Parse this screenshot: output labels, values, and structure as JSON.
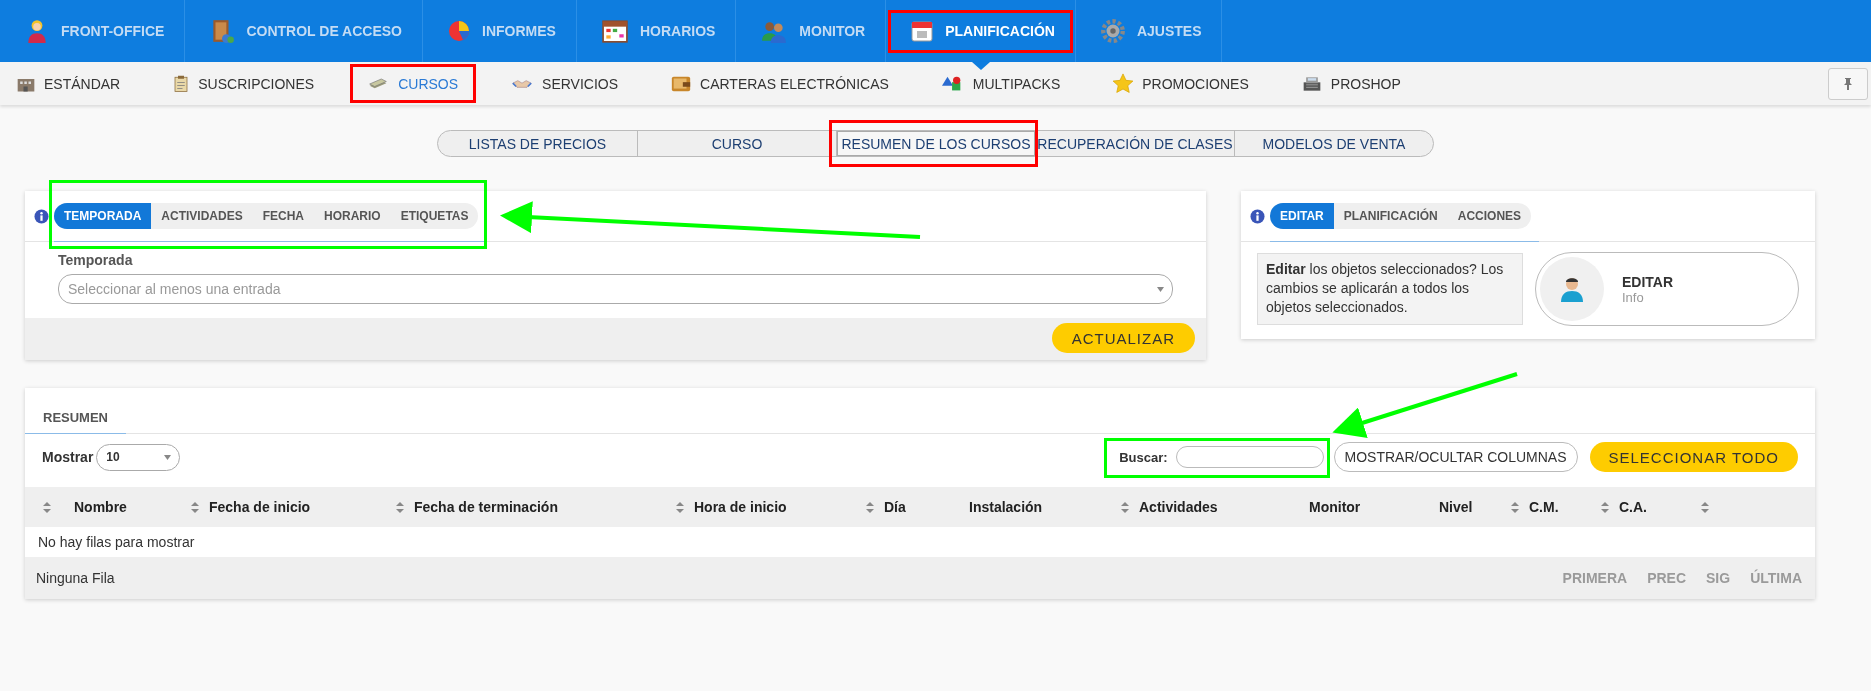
{
  "main_menu": [
    {
      "label": "FRONT-OFFICE",
      "selected": false
    },
    {
      "label": "CONTROL DE ACCESO",
      "selected": false
    },
    {
      "label": "INFORMES",
      "selected": false
    },
    {
      "label": "HORARIOS",
      "selected": false
    },
    {
      "label": "MONITOR",
      "selected": false
    },
    {
      "label": "PLANIFICACIÓN",
      "selected": true,
      "highlighted": true
    },
    {
      "label": "AJUSTES",
      "selected": false
    }
  ],
  "sub_menu": [
    {
      "label": "ESTÁNDAR",
      "selected": false
    },
    {
      "label": "SUSCRIPCIONES",
      "selected": false
    },
    {
      "label": "CURSOS",
      "selected": true,
      "highlighted": true
    },
    {
      "label": "SERVICIOS",
      "selected": false
    },
    {
      "label": "CARTERAS ELECTRÓNICAS",
      "selected": false
    },
    {
      "label": "MULTIPACKS",
      "selected": false
    },
    {
      "label": "PROMOCIONES",
      "selected": false
    },
    {
      "label": "PROSHOP",
      "selected": false
    }
  ],
  "view_tabs": [
    {
      "label": "LISTAS DE PRECIOS",
      "selected": false
    },
    {
      "label": "CURSO",
      "selected": false
    },
    {
      "label": "RESUMEN DE LOS CURSOS",
      "selected": true,
      "highlighted": true
    },
    {
      "label": "RECUPERACIÓN DE CLASES",
      "selected": false
    },
    {
      "label": "MODELOS DE VENTA",
      "selected": false
    }
  ],
  "filter_panel": {
    "tabs_highlighted": true,
    "tabs": [
      {
        "label": "TEMPORADA",
        "selected": true
      },
      {
        "label": "ACTIVIDADES",
        "selected": false
      },
      {
        "label": "FECHA",
        "selected": false
      },
      {
        "label": "HORARIO",
        "selected": false
      },
      {
        "label": "ETIQUETAS",
        "selected": false
      }
    ],
    "field_label": "Temporada",
    "field_placeholder": "Seleccionar al menos una entrada",
    "button": "ACTUALIZAR"
  },
  "action_panel": {
    "tabs": [
      {
        "label": "EDITAR",
        "selected": true
      },
      {
        "label": "PLANIFICACIÓN",
        "selected": false
      },
      {
        "label": "ACCIONES",
        "selected": false
      }
    ],
    "description": "**Editar** los objetos seleccionados? Los cambios se aplicarán a todos los objetos seleccionados.",
    "action_title": "EDITAR",
    "action_subtitle": "Info"
  },
  "summary": {
    "tab": "RESUMEN",
    "show_label": "Mostrar",
    "page_size": "10",
    "search_label": "Buscar:",
    "search_highlighted": true,
    "columns_button": "MOSTRAR/OCULTAR COLUMNAS",
    "select_all_button": "SELECCIONAR TODO",
    "columns": [
      {
        "sortable": true
      },
      {
        "label": "Nombre",
        "sortable": true
      },
      {
        "label": "Fecha de inicio",
        "sortable": true
      },
      {
        "label": "Fecha de terminación",
        "sortable": true
      },
      {
        "label": "Hora de inicio",
        "sortable": true
      },
      {
        "label": "Día",
        "sortable": false
      },
      {
        "label": "Instalación",
        "sortable": true
      },
      {
        "label": "Actividades",
        "sortable": false
      },
      {
        "label": "Monitor",
        "sortable": false
      },
      {
        "label": "Nivel",
        "sortable": true
      },
      {
        "label": "C.M.",
        "sortable": true
      },
      {
        "label": "C.A.",
        "sortable": true
      }
    ],
    "empty_message": "No hay filas para mostrar",
    "footer": "Ninguna Fila",
    "pager": [
      {
        "label": "PRIMERA",
        "disabled": true
      },
      {
        "label": "PREC",
        "disabled": true
      },
      {
        "label": "SIG",
        "disabled": true
      },
      {
        "label": "ÚLTIMA",
        "disabled": true
      }
    ]
  }
}
